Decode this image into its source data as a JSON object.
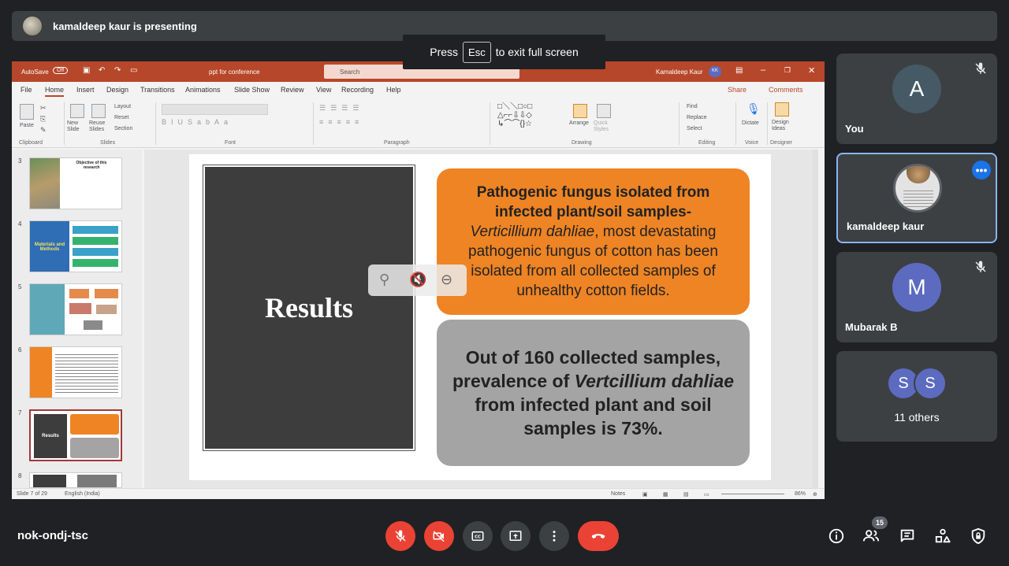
{
  "presenter": {
    "text": "kamaldeep kaur is presenting"
  },
  "fullscreen_toast": {
    "before": "Press",
    "key": "Esc",
    "after": "to exit full screen"
  },
  "ppt": {
    "autosave": "AutoSave",
    "autosave_state": "Off",
    "filename": "ppt for conference",
    "search_placeholder": "Search",
    "user": "Kamaldeep Kaur",
    "user_initials": "KK",
    "tabs": [
      "File",
      "Home",
      "Insert",
      "Design",
      "Transitions",
      "Animations",
      "Slide Show",
      "Review",
      "View",
      "Recording",
      "Help"
    ],
    "share": "Share",
    "comments": "Comments",
    "ribbon": {
      "clipboard": "Clipboard",
      "slides": "Slides",
      "font": "Font",
      "paragraph": "Paragraph",
      "drawing": "Drawing",
      "editing": "Editing",
      "voice": "Voice",
      "designer": "Designer",
      "new_slide": "New Slide",
      "reuse_slides": "Reuse Slides",
      "layout": "Layout",
      "reset": "Reset",
      "section": "Section",
      "arrange": "Arrange",
      "quick_styles": "Quick Styles",
      "find": "Find",
      "replace": "Replace",
      "select": "Select",
      "dictate": "Dictate",
      "design_ideas": "Design Ideas",
      "paste": "Paste"
    },
    "thumbnails": [
      {
        "num": "3",
        "title": "Objective of this research"
      },
      {
        "num": "4",
        "title": "Materials and Methods"
      },
      {
        "num": "5"
      },
      {
        "num": "6"
      },
      {
        "num": "7",
        "title": "Results"
      },
      {
        "num": "8"
      }
    ],
    "slide": {
      "title": "Results",
      "orange_bold": "Pathogenic fungus isolated from infected plant/soil samples-",
      "orange_italic": "Verticillium dahliae",
      "orange_rest": ", most devastating pathogenic fungus of cotton has been isolated from all collected samples of unhealthy cotton fields.",
      "gray_pre": "Out of 160 collected samples, prevalence of",
      "gray_italic": "Vertcillium dahliae",
      "gray_post": "from infected plant and soil samples is 73%."
    },
    "status": {
      "slide": "Slide 7 of 29",
      "language": "English (India)",
      "notes": "Notes",
      "zoom": "86%"
    }
  },
  "participants": [
    {
      "name": "You",
      "initial": "A",
      "color": "#455a64",
      "muted": true
    },
    {
      "name": "kamaldeep kaur",
      "presenting": true
    },
    {
      "name": "Mubarak B",
      "initial": "M",
      "color": "#5c6bc0",
      "muted": true
    },
    {
      "name": "11 others",
      "initials": [
        "S",
        "S"
      ]
    }
  ],
  "meeting": {
    "code": "nok-ondj-tsc",
    "people_count": "15"
  },
  "colors": {
    "accent": "#8ab4f8",
    "end_call": "#ea4335",
    "ppt_brand": "#b7472a"
  }
}
